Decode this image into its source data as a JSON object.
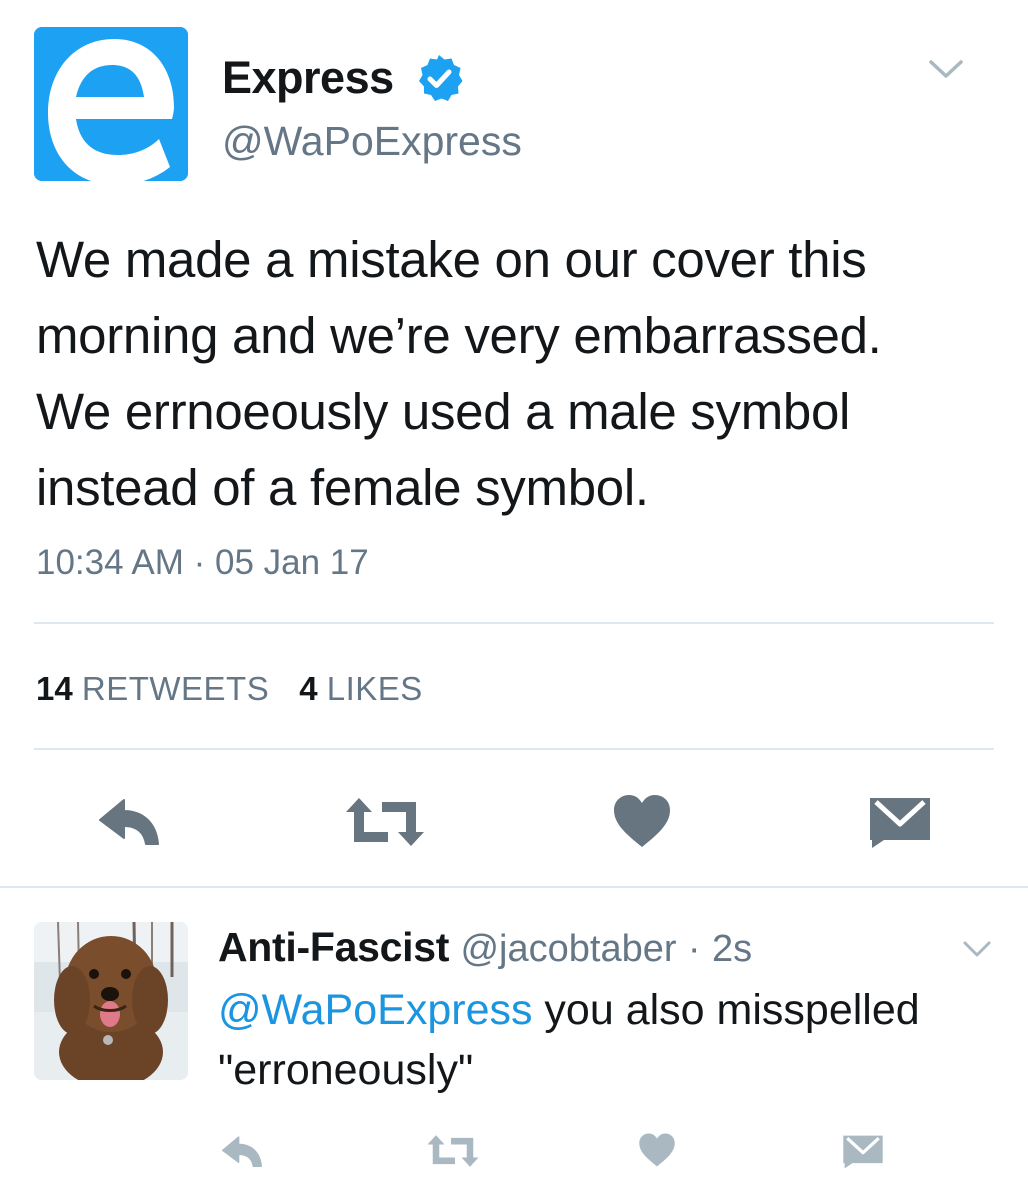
{
  "colors": {
    "brand_blue": "#1da1f2",
    "text_primary": "#14171a",
    "text_secondary": "#657786",
    "link_blue": "#1b95e0",
    "icon_gray_dark": "#66757f",
    "icon_gray_light": "#aab8c2",
    "divider": "#e1e8ed"
  },
  "main_tweet": {
    "avatar_icon": "express-logo-icon",
    "author_name": "Express",
    "verified": true,
    "author_handle": "@WaPoExpress",
    "text_lines": [
      "We made a mistake on our cover this",
      "morning and we’re very embarrassed.",
      "We errnoeously used a male symbol",
      "instead of a female symbol."
    ],
    "timestamp": "10:34 AM · 05 Jan 17",
    "stats": {
      "retweets_count": "14",
      "retweets_label": "RETWEETS",
      "likes_count": "4",
      "likes_label": "LIKES"
    },
    "actions": [
      "reply-icon",
      "retweet-icon",
      "like-icon",
      "direct-message-icon"
    ]
  },
  "reply_tweet": {
    "avatar_icon": "dog-avatar-icon",
    "author_name": "Anti-Fascist",
    "author_handle": "@jacobtaber",
    "separator": "·",
    "time": "2s",
    "mention": "@WaPoExpress",
    "text_rest_line1": " you also misspelled",
    "text_line2": "\"erroneously\"",
    "actions": [
      "reply-icon",
      "retweet-icon",
      "like-icon",
      "direct-message-icon"
    ]
  }
}
